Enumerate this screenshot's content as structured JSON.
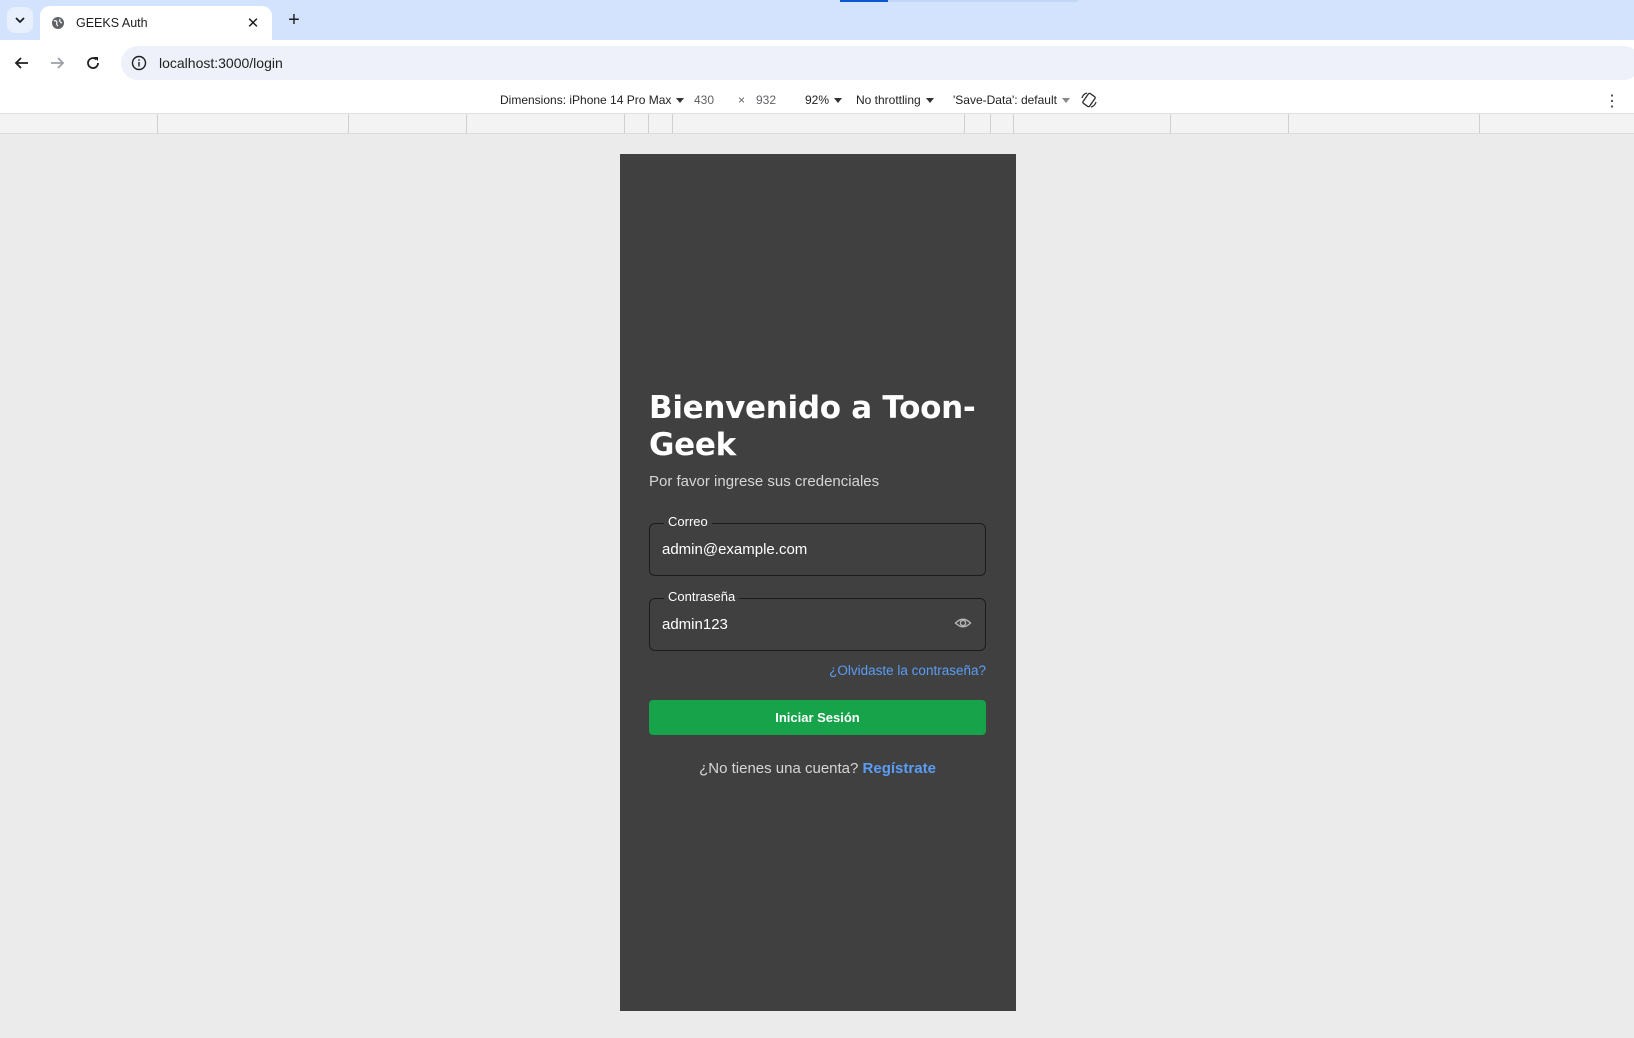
{
  "browser": {
    "tab_title": "GEEKS Auth",
    "tab_close": "✕",
    "new_tab": "+",
    "url": "localhost:3000/login"
  },
  "devtools": {
    "dimensions_label": "Dimensions: iPhone 14 Pro Max",
    "width": "430",
    "times": "×",
    "height": "932",
    "zoom": "92%",
    "throttling": "No throttling",
    "save_data": "'Save-Data': default",
    "more": "⋮"
  },
  "page": {
    "title": "Bienvenido a Toon-Geek",
    "subtitle": "Por favor ingrese sus credenciales",
    "email_label": "Correo",
    "email_value": "admin@example.com",
    "password_label": "Contraseña",
    "password_value": "admin123",
    "forgot_link": "¿Olvidaste la contraseña?",
    "login_button": "Iniciar Sesión",
    "no_account_text": "¿No tienes una cuenta?",
    "register_link": "Regístrate"
  },
  "colors": {
    "viewport_bg": "#404040",
    "button_green": "#16a34a",
    "link_blue": "#5b9df5"
  }
}
